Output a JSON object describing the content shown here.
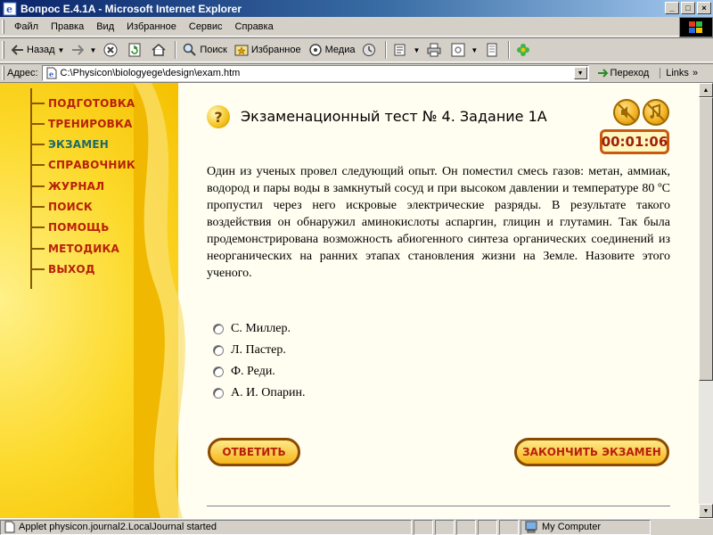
{
  "window": {
    "title": "Вопрос E.4.1A - Microsoft Internet Explorer",
    "controls": [
      "minimize",
      "maximize",
      "close"
    ]
  },
  "menu": {
    "items": [
      "Файл",
      "Правка",
      "Вид",
      "Избранное",
      "Сервис",
      "Справка"
    ]
  },
  "toolbar": {
    "back_label": "Назад",
    "search_label": "Поиск",
    "favorites_label": "Избранное",
    "media_label": "Медиа"
  },
  "address": {
    "label": "Адрес:",
    "url": "C:\\Physicon\\biologyege\\design\\exam.htm",
    "go_label": "Переход",
    "links_label": "Links"
  },
  "sidebar": {
    "items": [
      {
        "label": "ПОДГОТОВКА",
        "active": false
      },
      {
        "label": "ТРЕНИРОВКА",
        "active": false
      },
      {
        "label": "ЭКЗАМЕН",
        "active": true
      },
      {
        "label": "СПРАВОЧНИК",
        "active": false
      },
      {
        "label": "ЖУРНАЛ",
        "active": false
      },
      {
        "label": "ПОИСК",
        "active": false
      },
      {
        "label": "ПОМОЩЬ",
        "active": false
      },
      {
        "label": "МЕТОДИКА",
        "active": false
      },
      {
        "label": "ВЫХОД",
        "active": false
      }
    ]
  },
  "exam": {
    "title": "Экзаменационный тест № 4. Задание 1А",
    "timer": "00:01:06",
    "question": "Один из ученых провел следующий опыт. Он поместил смесь газов: метан, аммиак, водород и пары воды в замкнутый сосуд и при высоком давлении и температуре 80 ºC пропустил через него искровые электрические разряды. В результате такого воздействия он обнаружил аминокислоты аспаргин, глицин и глутамин. Так была продемонстрирована возможность абиогенного синтеза органических соединений из неорганических на ранних этапах становления жизни на Земле. Назовите этого ученого.",
    "options": [
      "С. Миллер.",
      "Л. Пастер.",
      "Ф. Реди.",
      "А. И. Опарин."
    ],
    "answer_button": "ОТВЕТИТЬ",
    "finish_button": "ЗАКОНЧИТЬ ЭКЗАМЕН"
  },
  "status": {
    "text": "Applet physicon.journal2.LocalJournal started",
    "zone": "My Computer"
  },
  "colors": {
    "nav_text": "#b8200a",
    "nav_active": "#1a6a6a",
    "timer_border": "#c85a10",
    "sidebar_yellow": "#fcd92a"
  }
}
